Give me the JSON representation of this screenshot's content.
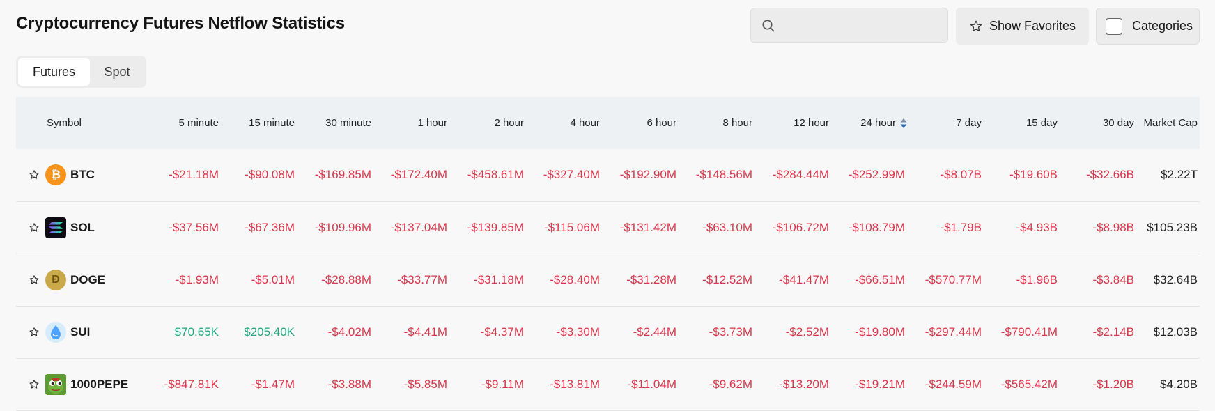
{
  "page": {
    "title": "Cryptocurrency Futures Netflow Statistics"
  },
  "toolbar": {
    "search_value": "",
    "favorites_label": "Show Favorites",
    "categories_label": "Categories"
  },
  "market_tabs": [
    {
      "label": "Futures",
      "active": true
    },
    {
      "label": "Spot",
      "active": false
    }
  ],
  "table": {
    "sorted_column": "24 hour",
    "columns": [
      "Symbol",
      "5 minute",
      "15 minute",
      "30 minute",
      "1 hour",
      "2 hour",
      "4 hour",
      "6 hour",
      "8 hour",
      "12 hour",
      "24 hour",
      "7 day",
      "15 day",
      "30 day",
      "Market Cap"
    ],
    "rows": [
      {
        "symbol": "BTC",
        "icon": "bitcoin-icon",
        "values": [
          "-$21.18M",
          "-$90.08M",
          "-$169.85M",
          "-$172.40M",
          "-$458.61M",
          "-$327.40M",
          "-$192.90M",
          "-$148.56M",
          "-$284.44M",
          "-$252.99M",
          "-$8.07B",
          "-$19.60B",
          "-$32.66B"
        ],
        "market_cap": "$2.22T"
      },
      {
        "symbol": "SOL",
        "icon": "solana-icon",
        "values": [
          "-$37.56M",
          "-$67.36M",
          "-$109.96M",
          "-$137.04M",
          "-$139.85M",
          "-$115.06M",
          "-$131.42M",
          "-$63.10M",
          "-$106.72M",
          "-$108.79M",
          "-$1.79B",
          "-$4.93B",
          "-$8.98B"
        ],
        "market_cap": "$105.23B"
      },
      {
        "symbol": "DOGE",
        "icon": "dogecoin-icon",
        "values": [
          "-$1.93M",
          "-$5.01M",
          "-$28.88M",
          "-$33.77M",
          "-$31.18M",
          "-$28.40M",
          "-$31.28M",
          "-$12.52M",
          "-$41.47M",
          "-$66.51M",
          "-$570.77M",
          "-$1.96B",
          "-$3.84B"
        ],
        "market_cap": "$32.64B"
      },
      {
        "symbol": "SUI",
        "icon": "sui-icon",
        "values": [
          "$70.65K",
          "$205.40K",
          "-$4.02M",
          "-$4.41M",
          "-$4.37M",
          "-$3.30M",
          "-$2.44M",
          "-$3.73M",
          "-$2.52M",
          "-$19.80M",
          "-$297.44M",
          "-$790.41M",
          "-$2.14B"
        ],
        "market_cap": "$12.03B"
      },
      {
        "symbol": "1000PEPE",
        "icon": "pepe-icon",
        "values": [
          "-$847.81K",
          "-$1.47M",
          "-$3.88M",
          "-$5.85M",
          "-$9.11M",
          "-$13.81M",
          "-$11.04M",
          "-$9.62M",
          "-$13.20M",
          "-$19.21M",
          "-$244.59M",
          "-$565.42M",
          "-$1.20B"
        ],
        "market_cap": "$4.20B"
      }
    ]
  },
  "colors": {
    "negative": "#d9364b",
    "positive": "#21a57e",
    "header_bg": "#eef1f4",
    "sort_active": "#2b6cb0"
  }
}
